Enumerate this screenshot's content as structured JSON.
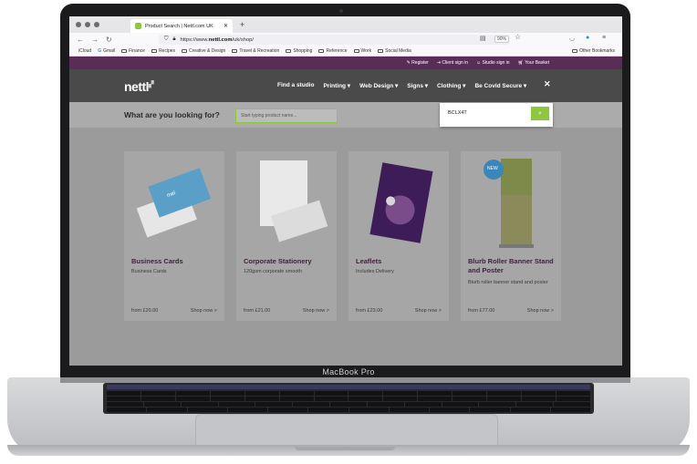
{
  "laptop": {
    "brand": "MacBook Pro"
  },
  "browser": {
    "tab_title": "Product Search | Nettl.com UK",
    "url_prefix": "https://www.",
    "url_domain": "nettl.com",
    "url_path": "/uk/shop/",
    "zoom": "90%",
    "bookmarks": [
      "iCloud",
      "Gmail",
      "Finance",
      "Recipes",
      "Creative & Design",
      "Travel & Recreation",
      "Shopping",
      "Reference",
      "Work",
      "Social Media"
    ],
    "other_bookmarks": "Other Bookmarks"
  },
  "site": {
    "top_links": [
      "Register",
      "Client sign in",
      "Studio sign in",
      "Your Basket"
    ],
    "logo": "nettl",
    "menu": [
      "Find a studio",
      "Printing ▾",
      "Web Design ▾",
      "Signs ▾",
      "Clothing ▾",
      "Be Covid Secure ▾"
    ],
    "close": "✕",
    "search_question": "What are you looking for?",
    "search_placeholder": "Start typing product name...",
    "popup_value": "BCLX4T",
    "popup_button_icon": "search-icon"
  },
  "products": [
    {
      "title": "Business Cards",
      "desc": "Business Cards",
      "price": "from £20.00",
      "shop": "Shop now >"
    },
    {
      "title": "Corporate Stationery",
      "desc": "120gsm corporate smooth",
      "price": "from £21.00",
      "shop": "Shop now >"
    },
    {
      "title": "Leaflets",
      "desc": "Includes Delivery",
      "price": "from £23.00",
      "shop": "Shop now >"
    },
    {
      "title": "Blurb Roller Banner Stand and Poster",
      "desc": "Blurb roller banner stand and poster",
      "price": "from £77.00",
      "shop": "Shop now >"
    }
  ],
  "colors": {
    "purple": "#5a2d58",
    "green": "#8dc63f",
    "nav": "#4a4a4a"
  }
}
